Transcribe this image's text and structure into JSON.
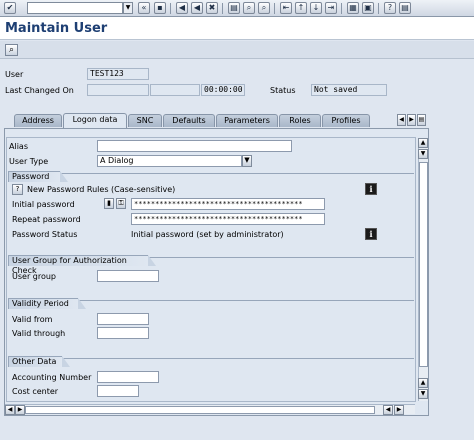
{
  "toolbar": {
    "ok_icon": "check-icon",
    "buttons": [
      "«",
      "💾",
      "◀",
      "◀",
      "✖",
      "🖶",
      "⌕",
      "⌕",
      "⇤",
      "↑",
      "↓",
      "⇥",
      "▦",
      "▣",
      "?",
      "▤"
    ]
  },
  "title": "Maintain User",
  "header": {
    "user_label": "User",
    "user_value": "TEST123",
    "last_changed_label": "Last Changed On",
    "last_changed_time": "00:00:00",
    "status_label": "Status",
    "status_value": "Not saved"
  },
  "tabs": [
    {
      "label": "Address",
      "active": false
    },
    {
      "label": "Logon data",
      "active": true
    },
    {
      "label": "SNC",
      "active": false
    },
    {
      "label": "Defaults",
      "active": false
    },
    {
      "label": "Parameters",
      "active": false
    },
    {
      "label": "Roles",
      "active": false
    },
    {
      "label": "Profiles",
      "active": false
    }
  ],
  "form": {
    "alias_label": "Alias",
    "alias_value": "",
    "user_type_label": "User Type",
    "user_type_value": "A Dialog",
    "password_group": "Password",
    "new_pw_rules": "New Password Rules (Case-sensitive)",
    "initial_pw_label": "Initial password",
    "initial_pw_value": "****************************************",
    "repeat_pw_label": "Repeat password",
    "repeat_pw_value": "****************************************",
    "pw_status_label": "Password Status",
    "pw_status_value": "Initial password (set by administrator)",
    "auth_group": "User Group for Authorization Check",
    "user_group_label": "User group",
    "validity_group": "Validity Period",
    "valid_from_label": "Valid from",
    "valid_through_label": "Valid through",
    "other_group": "Other Data",
    "accounting_label": "Accounting Number",
    "cost_center_label": "Cost center"
  }
}
